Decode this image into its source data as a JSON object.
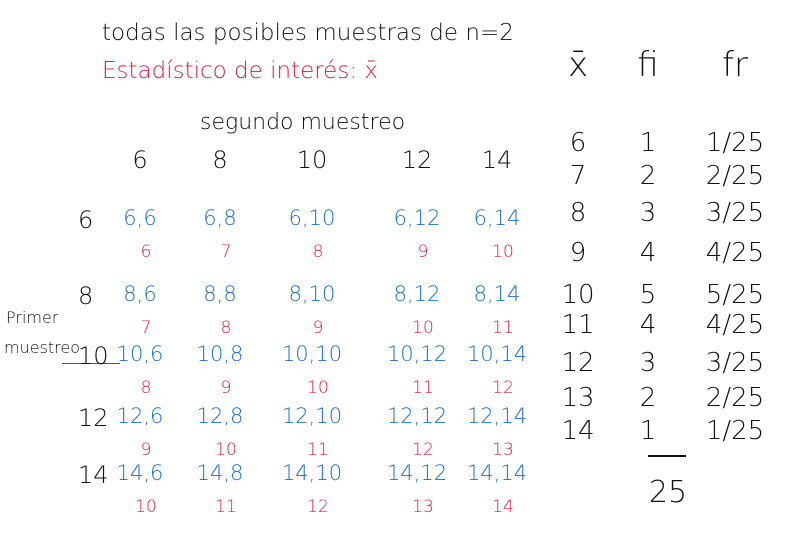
{
  "title": "todas las posibles muestras de n=2",
  "subtitle": "Estadístico de interés: x̄",
  "col_header_label": "segundo muestreo",
  "row_header_label": [
    "Primer",
    "muestreo"
  ],
  "col_values": [
    "6",
    "8",
    "10",
    "12",
    "14"
  ],
  "row_values": [
    "6",
    "8",
    "10",
    "12",
    "14"
  ],
  "samples": [
    [
      {
        "pair": "6,6",
        "mean": "6"
      },
      {
        "pair": "6,8",
        "mean": "7"
      },
      {
        "pair": "6,10",
        "mean": "8"
      },
      {
        "pair": "6,12",
        "mean": "9"
      },
      {
        "pair": "6,14",
        "mean": "10"
      }
    ],
    [
      {
        "pair": "8,6",
        "mean": "7"
      },
      {
        "pair": "8,8",
        "mean": "8"
      },
      {
        "pair": "8,10",
        "mean": "9"
      },
      {
        "pair": "8,12",
        "mean": "10"
      },
      {
        "pair": "8,14",
        "mean": "11"
      }
    ],
    [
      {
        "pair": "10,6",
        "mean": "8"
      },
      {
        "pair": "10,8",
        "mean": "9"
      },
      {
        "pair": "10,10",
        "mean": "10"
      },
      {
        "pair": "10,12",
        "mean": "11"
      },
      {
        "pair": "10,14",
        "mean": "12"
      }
    ],
    [
      {
        "pair": "12,6",
        "mean": "9"
      },
      {
        "pair": "12,8",
        "mean": "10"
      },
      {
        "pair": "12,10",
        "mean": "11"
      },
      {
        "pair": "12,12",
        "mean": "12"
      },
      {
        "pair": "12,14",
        "mean": "13"
      }
    ],
    [
      {
        "pair": "14,6",
        "mean": "10"
      },
      {
        "pair": "14,8",
        "mean": "11"
      },
      {
        "pair": "14,10",
        "mean": "12"
      },
      {
        "pair": "14,12",
        "mean": "13"
      },
      {
        "pair": "14,14",
        "mean": "14"
      }
    ]
  ],
  "freq_table": {
    "headers": [
      "x̄",
      "fi",
      "fr"
    ],
    "rows": [
      {
        "x": "6",
        "fi": "1",
        "fr": "1/25"
      },
      {
        "x": "7",
        "fi": "2",
        "fr": "2/25"
      },
      {
        "x": "8",
        "fi": "3",
        "fr": "3/25"
      },
      {
        "x": "9",
        "fi": "4",
        "fr": "4/25"
      },
      {
        "x": "10",
        "fi": "5",
        "fr": "5/25"
      },
      {
        "x": "11",
        "fi": "4",
        "fr": "4/25"
      },
      {
        "x": "12",
        "fi": "3",
        "fr": "3/25"
      },
      {
        "x": "13",
        "fi": "2",
        "fr": "2/25"
      },
      {
        "x": "14",
        "fi": "1",
        "fr": "1/25"
      }
    ],
    "total": "25"
  }
}
